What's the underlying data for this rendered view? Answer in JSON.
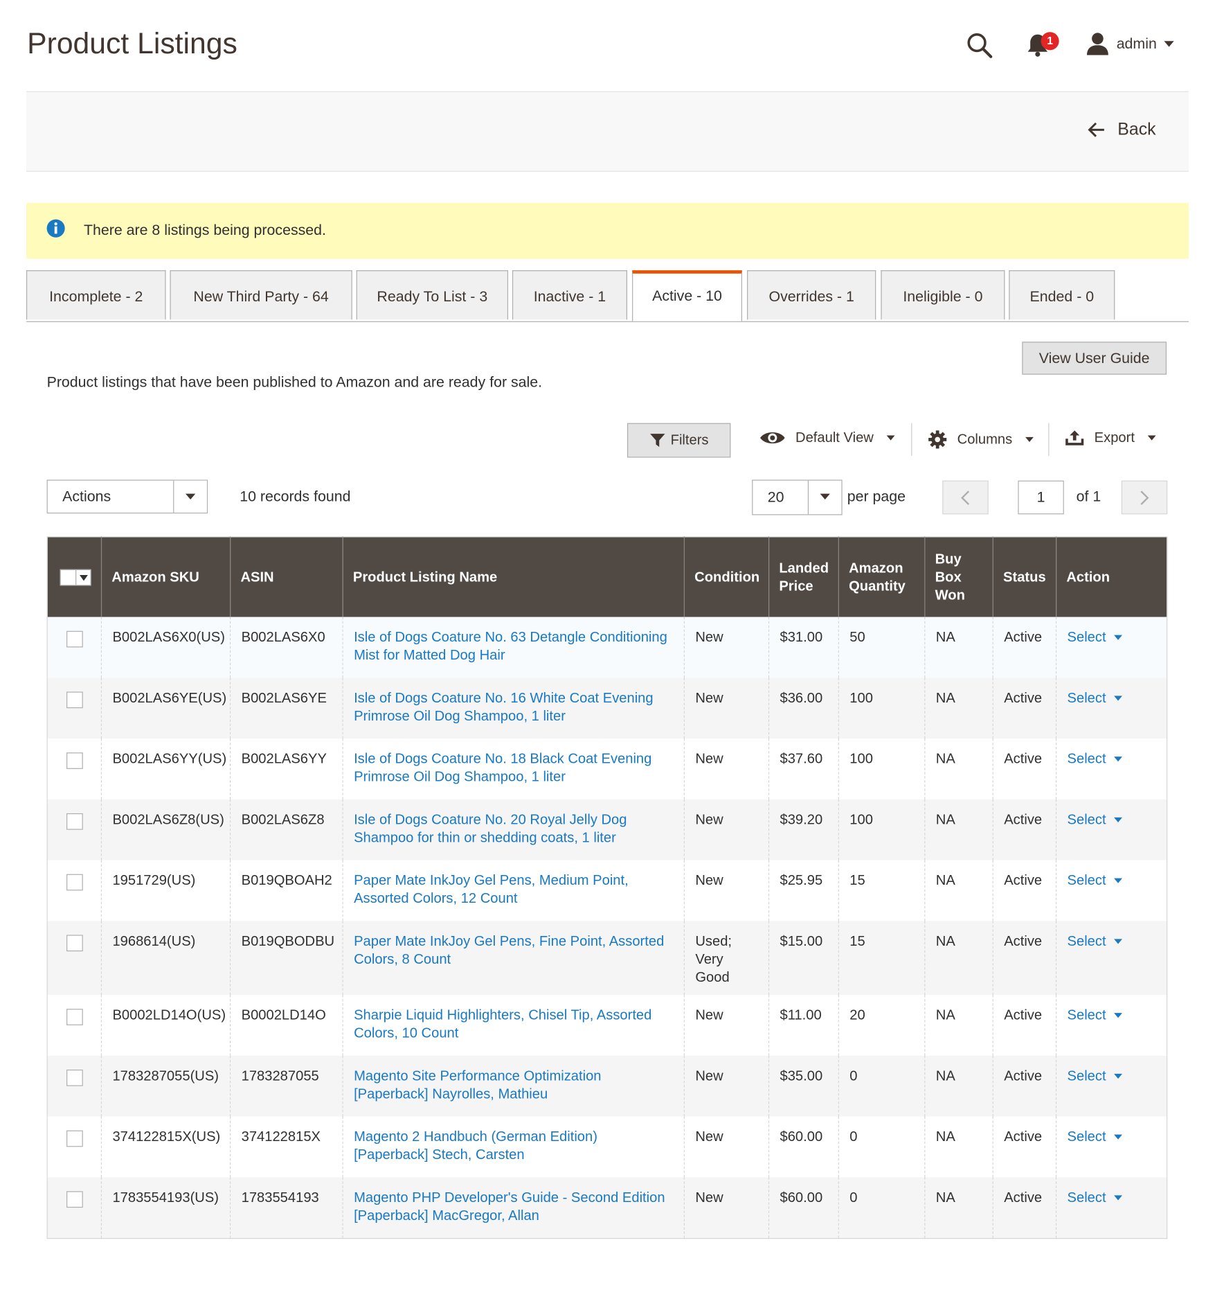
{
  "header": {
    "title": "Product Listings",
    "notification_count": "1",
    "user_name": "admin"
  },
  "action_bar": {
    "back_label": "Back"
  },
  "message": {
    "text": "There are 8 listings being processed."
  },
  "tabs": [
    {
      "label": "Incomplete - 2"
    },
    {
      "label": "New Third Party - 64"
    },
    {
      "label": "Ready To List - 3"
    },
    {
      "label": "Inactive - 1"
    },
    {
      "label": "Active - 10"
    },
    {
      "label": "Overrides - 1"
    },
    {
      "label": "Ineligible - 0"
    },
    {
      "label": "Ended - 0"
    }
  ],
  "active_tab": "Active - 10",
  "guide": {
    "label": "View User Guide"
  },
  "description": "Product listings that have been published to Amazon and are ready for sale.",
  "toolbar": {
    "filters_label": "Filters",
    "view_label": "Default View",
    "columns_label": "Columns",
    "export_label": "Export"
  },
  "mass_actions": {
    "label": "Actions"
  },
  "records_found": "10 records found",
  "pagination": {
    "per_page_value": "20",
    "per_page_label": "per page",
    "current_page": "1",
    "of_label": "of 1"
  },
  "grid": {
    "columns": [
      "Amazon SKU",
      "ASIN",
      "Product Listing Name",
      "Condition",
      "Landed Price",
      "Amazon Quantity",
      "Buy Box Won",
      "Status",
      "Action"
    ],
    "rows": [
      {
        "sku": "B002LAS6X0(US)",
        "asin": "B002LAS6X0",
        "name": "Isle of Dogs Coature No. 63 Detangle Conditioning Mist for Matted Dog Hair",
        "condition": "New",
        "price": "$31.00",
        "qty": "50",
        "buybox": "NA",
        "status": "Active",
        "action": "Select"
      },
      {
        "sku": "B002LAS6YE(US)",
        "asin": "B002LAS6YE",
        "name": "Isle of Dogs Coature No. 16 White Coat Evening Primrose Oil Dog Shampoo, 1 liter",
        "condition": "New",
        "price": "$36.00",
        "qty": "100",
        "buybox": "NA",
        "status": "Active",
        "action": "Select"
      },
      {
        "sku": "B002LAS6YY(US)",
        "asin": "B002LAS6YY",
        "name": "Isle of Dogs Coature No. 18 Black Coat Evening Primrose Oil Dog Shampoo, 1 liter",
        "condition": "New",
        "price": "$37.60",
        "qty": "100",
        "buybox": "NA",
        "status": "Active",
        "action": "Select"
      },
      {
        "sku": "B002LAS6Z8(US)",
        "asin": "B002LAS6Z8",
        "name": "Isle of Dogs Coature No. 20 Royal Jelly Dog Shampoo for thin or shedding coats, 1 liter",
        "condition": "New",
        "price": "$39.20",
        "qty": "100",
        "buybox": "NA",
        "status": "Active",
        "action": "Select"
      },
      {
        "sku": "1951729(US)",
        "asin": "B019QBOAH2",
        "name": "Paper Mate InkJoy Gel Pens, Medium Point, Assorted Colors, 12 Count",
        "condition": "New",
        "price": "$25.95",
        "qty": "15",
        "buybox": "NA",
        "status": "Active",
        "action": "Select"
      },
      {
        "sku": "1968614(US)",
        "asin": "B019QBODBU",
        "name": "Paper Mate InkJoy Gel Pens, Fine Point, Assorted Colors, 8 Count",
        "condition": "Used; Very Good",
        "price": "$15.00",
        "qty": "15",
        "buybox": "NA",
        "status": "Active",
        "action": "Select"
      },
      {
        "sku": "B0002LD14O(US)",
        "asin": "B0002LD14O",
        "name": "Sharpie Liquid Highlighters, Chisel Tip, Assorted Colors, 10 Count",
        "condition": "New",
        "price": "$11.00",
        "qty": "20",
        "buybox": "NA",
        "status": "Active",
        "action": "Select"
      },
      {
        "sku": "1783287055(US)",
        "asin": "1783287055",
        "name": "Magento Site Performance Optimization [Paperback] Nayrolles, Mathieu",
        "condition": "New",
        "price": "$35.00",
        "qty": "0",
        "buybox": "NA",
        "status": "Active",
        "action": "Select"
      },
      {
        "sku": "374122815X(US)",
        "asin": "374122815X",
        "name": "Magento 2 Handbuch (German Edition) [Paperback] Stech, Carsten",
        "condition": "New",
        "price": "$60.00",
        "qty": "0",
        "buybox": "NA",
        "status": "Active",
        "action": "Select"
      },
      {
        "sku": "1783554193(US)",
        "asin": "1783554193",
        "name": "Magento PHP Developer's Guide - Second Edition [Paperback] MacGregor, Allan",
        "condition": "New",
        "price": "$60.00",
        "qty": "0",
        "buybox": "NA",
        "status": "Active",
        "action": "Select"
      }
    ]
  },
  "colors": {
    "accent_tab": "#eb5202",
    "link": "#1979c3",
    "grid_header": "#514943",
    "message_bg": "#fffbbb",
    "badge": "#e22626"
  }
}
